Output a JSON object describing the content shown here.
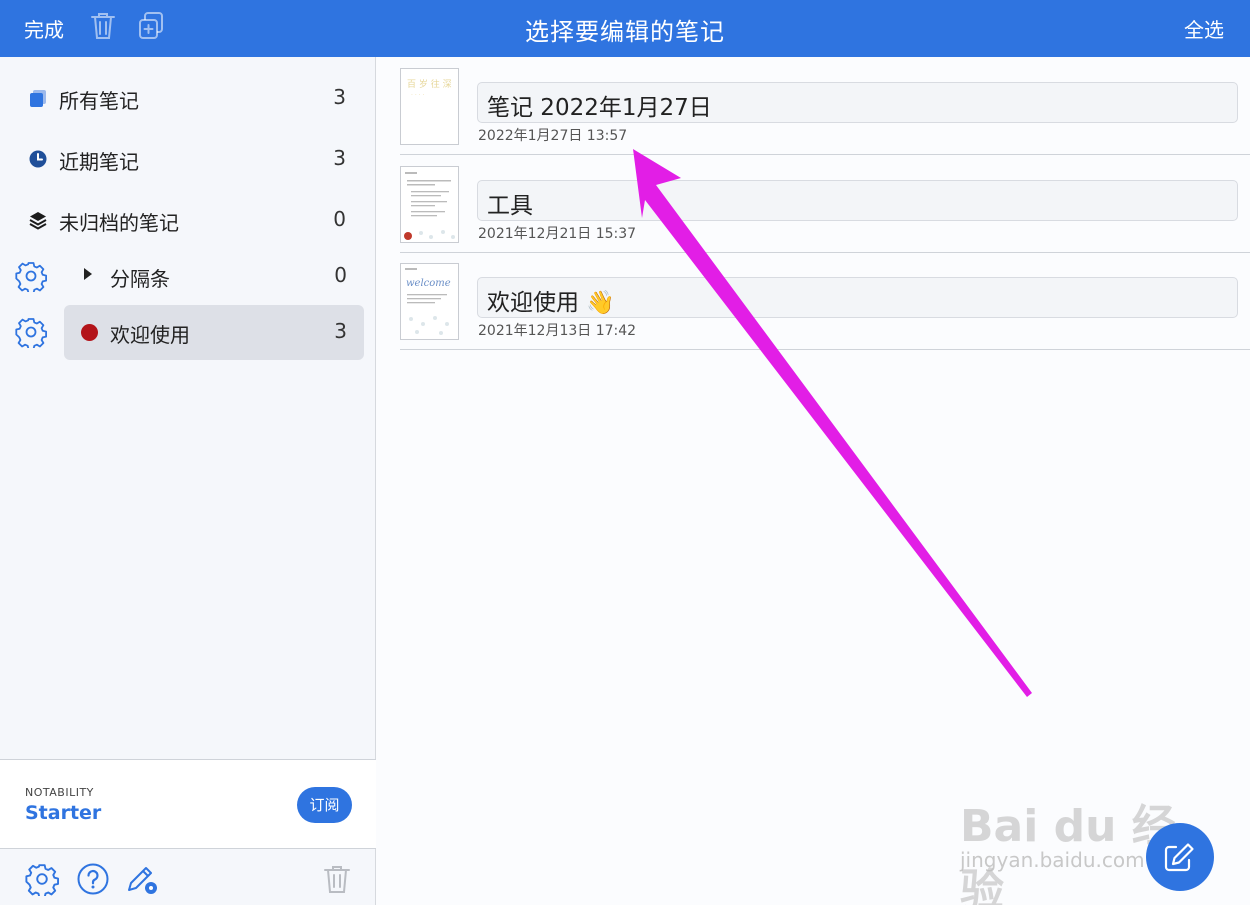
{
  "topbar": {
    "done": "完成",
    "title": "选择要编辑的笔记",
    "select_all": "全选"
  },
  "sidebar": {
    "items": [
      {
        "label": "所有笔记",
        "count": "3",
        "icon": "notes-stack-icon"
      },
      {
        "label": "近期笔记",
        "count": "3",
        "icon": "clock-icon"
      },
      {
        "label": "未归档的笔记",
        "count": "0",
        "icon": "layers-icon"
      }
    ],
    "subjects": [
      {
        "label": "分隔条",
        "count": "0",
        "icon": "disclosure-triangle-icon"
      },
      {
        "label": "欢迎使用",
        "count": "3",
        "color": "#b3141a",
        "selected": true
      }
    ],
    "plan": {
      "brand": "NOTABILITY",
      "tier": "Starter",
      "subscribe": "订阅"
    }
  },
  "notes": [
    {
      "title": "笔记 2022年1月27日",
      "date": "2022年1月27日 13:57"
    },
    {
      "title": "工具",
      "date": "2021年12月21日 15:37"
    },
    {
      "title": "欢迎使用 👋",
      "date": "2021年12月13日 17:42"
    }
  ],
  "watermark": {
    "line1": "Bai du 经验",
    "line2": "jingyan.baidu.com"
  },
  "colors": {
    "accent": "#2f74e0",
    "subject_red": "#b3141a",
    "arrow": "#e21ee6"
  }
}
